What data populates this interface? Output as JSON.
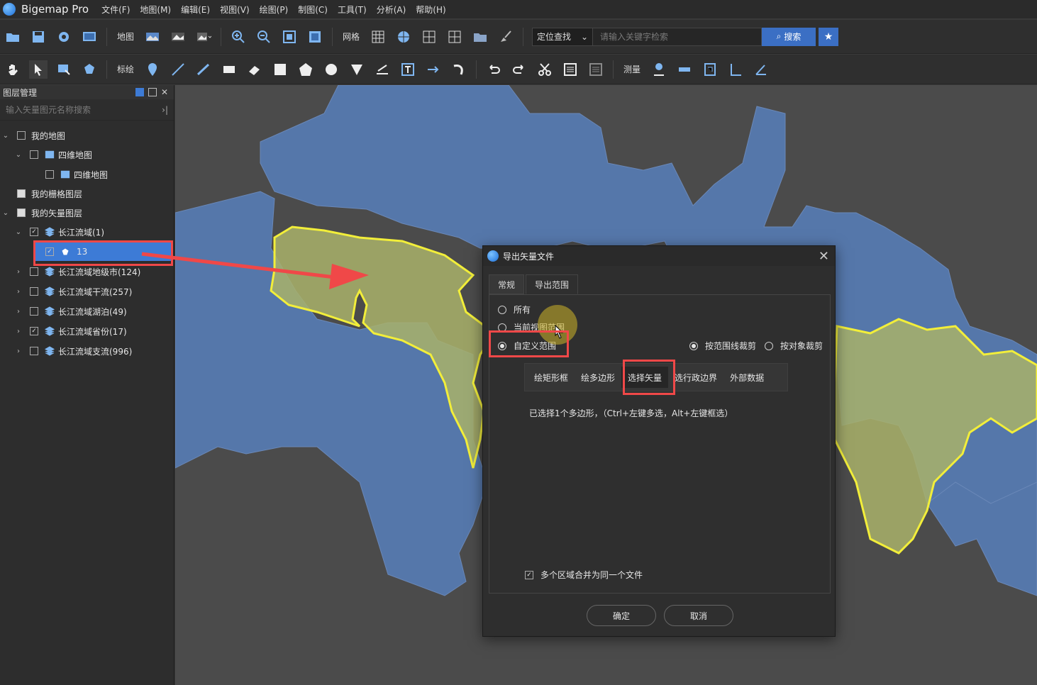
{
  "app": {
    "name": "Bigemap Pro"
  },
  "menu": [
    "文件(F)",
    "地图(M)",
    "编辑(E)",
    "视图(V)",
    "绘图(P)",
    "制图(C)",
    "工具(T)",
    "分析(A)",
    "帮助(H)"
  ],
  "toolbar1": {
    "map_label": "地图",
    "grid_label": "网格",
    "locate_select": "定位查找",
    "search_placeholder": "请输入关键字检索",
    "search_button": "搜索"
  },
  "toolbar2": {
    "draw_label": "标绘",
    "measure_label": "测量"
  },
  "layer_panel": {
    "title": "图层管理",
    "search_placeholder": "输入矢量图元名称搜索",
    "items": [
      {
        "label": "我的地图",
        "checked": false
      },
      {
        "label": "四维地图",
        "checked": false
      },
      {
        "label": "四维地图",
        "checked": false
      },
      {
        "label": "我的栅格图层",
        "checked": false
      },
      {
        "label": "我的矢量图层",
        "checked": false
      },
      {
        "label": "长江流域(1)",
        "checked": true
      },
      {
        "label": "13",
        "checked": true
      },
      {
        "label": "长江流域地级市(124)",
        "checked": false
      },
      {
        "label": "长江流域干流(257)",
        "checked": false
      },
      {
        "label": "长江流域湖泊(49)",
        "checked": false
      },
      {
        "label": "长江流域省份(17)",
        "checked": true
      },
      {
        "label": "长江流域支流(996)",
        "checked": false
      }
    ]
  },
  "dialog": {
    "title": "导出矢量文件",
    "tabs": [
      "常规",
      "导出范围"
    ],
    "options": {
      "all": "所有",
      "current_view": "当前视图范围",
      "custom": "自定义范围",
      "clip_by_range": "按范围线裁剪",
      "clip_by_object": "按对象裁剪"
    },
    "range_buttons": [
      "绘矩形框",
      "绘多边形",
      "选择矢量",
      "选行政边界",
      "外部数据"
    ],
    "selection_info": "已选择1个多边形，（Ctrl+左键多选，Alt+左键框选）",
    "merge_label": "多个区域合并为同一个文件",
    "ok": "确定",
    "cancel": "取消"
  },
  "colors": {
    "map_blue": "#5577aa",
    "highlight_yellow": "#f2ee3a",
    "annotation_red": "#f04848",
    "selected_row": "#3d7bd6"
  }
}
